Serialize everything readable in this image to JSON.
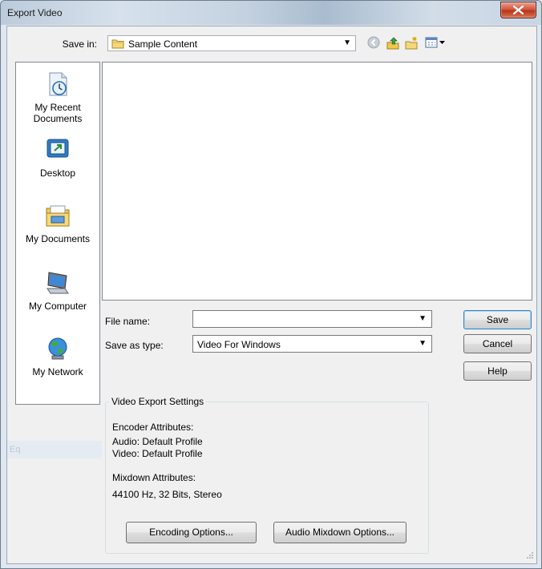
{
  "window": {
    "title": "Export Video"
  },
  "toolbar": {
    "save_in_label": "Save in:",
    "save_in_value": "Sample Content",
    "icons": [
      "back-icon",
      "up-folder-icon",
      "new-folder-icon",
      "views-menu-icon"
    ]
  },
  "places": [
    {
      "label": "My Recent Documents",
      "icon": "recent-documents-icon"
    },
    {
      "label": "Desktop",
      "icon": "desktop-icon"
    },
    {
      "label": "My Documents",
      "icon": "my-documents-icon"
    },
    {
      "label": "My Computer",
      "icon": "my-computer-icon"
    },
    {
      "label": "My Network",
      "icon": "my-network-icon"
    }
  ],
  "form": {
    "file_name_label": "File name:",
    "file_name_value": "",
    "save_as_type_label": "Save as type:",
    "save_as_type_value": "Video For Windows"
  },
  "buttons": {
    "save": "Save",
    "cancel": "Cancel",
    "help": "Help"
  },
  "settings": {
    "group_title": "Video Export Settings",
    "encoder_heading": "Encoder Attributes:",
    "audio": "Audio: Default Profile",
    "video": "Video: Default Profile",
    "mixdown_heading": "Mixdown Attributes:",
    "mixdown_value": "44100 Hz, 32 Bits, Stereo",
    "encoding_options": "Encoding Options...",
    "audio_mixdown_options": "Audio Mixdown Options..."
  },
  "background_fragment": "Eq",
  "colors": {
    "client": "#f0f0f0",
    "frame": "#dfe7f0",
    "close": "#c8442a"
  }
}
